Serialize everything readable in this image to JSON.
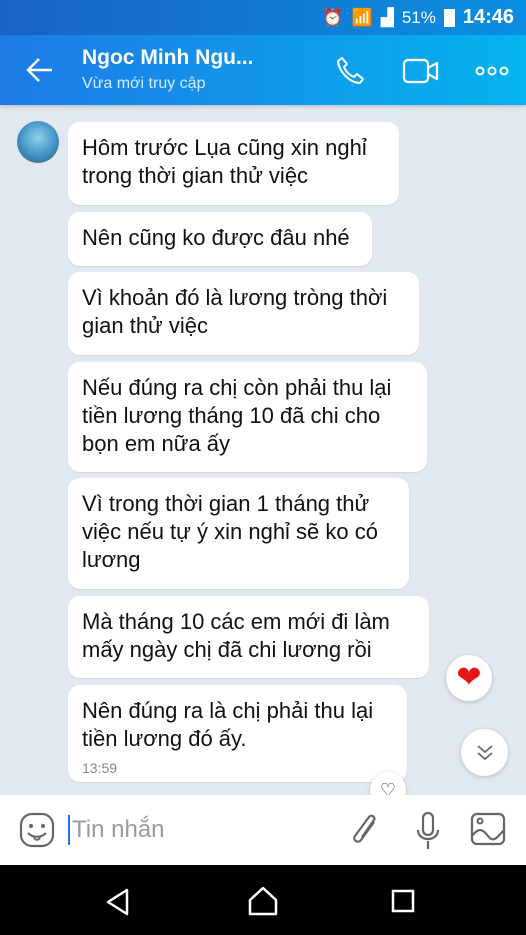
{
  "status_bar": {
    "battery": "51%",
    "time": "14:46"
  },
  "header": {
    "title": "Ngoc Minh Ngu...",
    "subtitle": "Vừa mới truy cập"
  },
  "messages": [
    {
      "text": "Hôm trước Lụa cũng xin nghỉ trong thời gian thử việc"
    },
    {
      "text": "Nên cũng ko được đâu nhé"
    },
    {
      "text": "Vì khoản đó là lương tròng thời gian thử việc"
    },
    {
      "text": "Nếu đúng ra chị còn phải thu lại tiền lương tháng 10 đã chi cho bọn em nữa ấy"
    },
    {
      "text": "Vì trong thời gian 1 tháng thử việc nếu tự ý xin nghỉ sẽ ko có lương"
    },
    {
      "text": "Mà tháng 10 các em mới đi làm mấy ngày chị đã chi lương rồi"
    },
    {
      "text": "Nên đúng ra là chị phải thu lại tiền lương đó ấy.",
      "time": "13:59"
    }
  ],
  "input": {
    "placeholder": "Tin nhắn"
  }
}
